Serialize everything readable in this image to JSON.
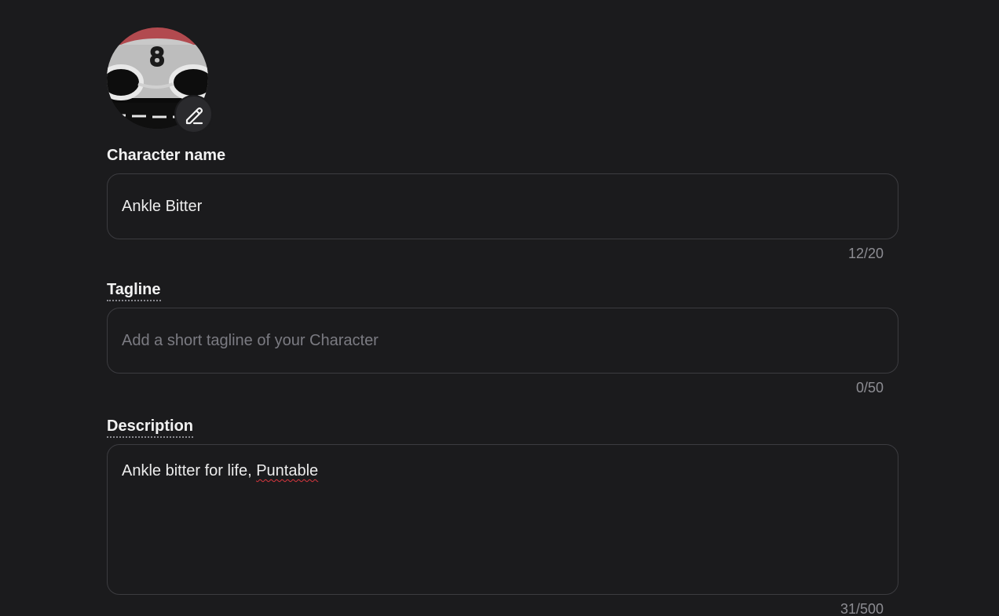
{
  "avatar": {
    "icon": "eight-ball-avatar",
    "edit_icon": "pencil-icon"
  },
  "name_field": {
    "label": "Character name",
    "value": "Ankle Bitter",
    "counter": "12/20"
  },
  "tagline_field": {
    "label": "Tagline",
    "value": "",
    "placeholder": "Add a short tagline of your Character",
    "counter": "0/50"
  },
  "description_field": {
    "label": "Description",
    "value_prefix": "Ankle bitter for life, ",
    "value_misspelled": "Puntable",
    "counter": "31/500"
  },
  "colors": {
    "background": "#1b1b1d",
    "border": "#3c3c40",
    "text": "#ececec",
    "muted": "#8d8d93",
    "spellcheck": "#d9363e"
  }
}
